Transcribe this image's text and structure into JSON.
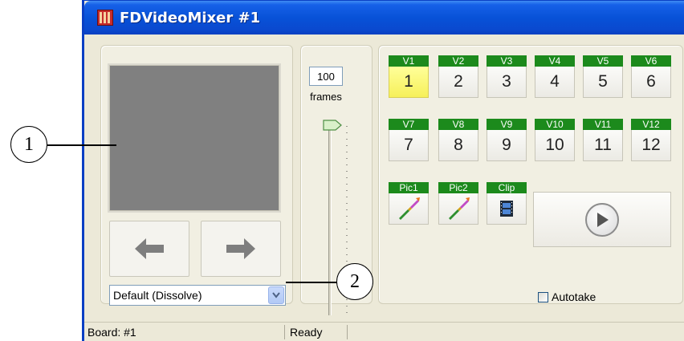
{
  "window": {
    "title": "FDVideoMixer #1"
  },
  "callouts": [
    "1",
    "2"
  ],
  "slider": {
    "frames_value": "100",
    "frames_label": "frames",
    "level": 1.0
  },
  "transition": {
    "selected": "Default (Dissolve)"
  },
  "video_buttons": [
    {
      "label": "V1",
      "number": "1",
      "active": true
    },
    {
      "label": "V2",
      "number": "2",
      "active": false
    },
    {
      "label": "V3",
      "number": "3",
      "active": false
    },
    {
      "label": "V4",
      "number": "4",
      "active": false
    },
    {
      "label": "V5",
      "number": "5",
      "active": false
    },
    {
      "label": "V6",
      "number": "6",
      "active": false
    },
    {
      "label": "V7",
      "number": "7",
      "active": false
    },
    {
      "label": "V8",
      "number": "8",
      "active": false
    },
    {
      "label": "V9",
      "number": "9",
      "active": false
    },
    {
      "label": "V10",
      "number": "10",
      "active": false
    },
    {
      "label": "V11",
      "number": "11",
      "active": false
    },
    {
      "label": "V12",
      "number": "12",
      "active": false
    }
  ],
  "media_buttons": [
    {
      "label": "Pic1",
      "icon": "brush-icon"
    },
    {
      "label": "Pic2",
      "icon": "brush-icon"
    },
    {
      "label": "Clip",
      "icon": "film-icon"
    }
  ],
  "play_icon": "play-icon",
  "autotake": {
    "label": "Autotake",
    "checked": false
  },
  "status": {
    "board": "Board: #1",
    "state": "Ready"
  },
  "colors": {
    "title_bar": "#0852d8",
    "label_green": "#1c8a1c",
    "active_yellow": "#f6f05a",
    "preview_gray": "#808080"
  }
}
